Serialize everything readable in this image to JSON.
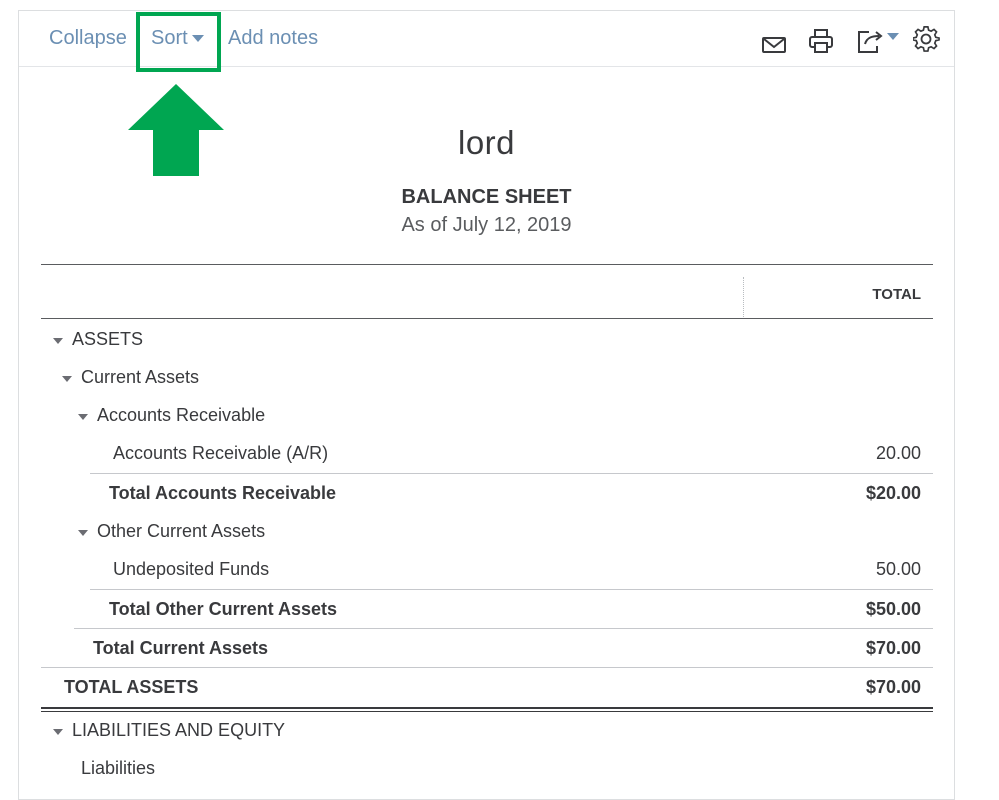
{
  "toolbar": {
    "collapse_label": "Collapse",
    "sort_label": "Sort",
    "add_notes_label": "Add notes",
    "icons": [
      "email-icon",
      "print-icon",
      "export-icon",
      "settings-icon"
    ]
  },
  "report": {
    "company": "lord",
    "title": "BALANCE SHEET",
    "date": "As of July 12, 2019",
    "column_header": "TOTAL"
  },
  "rows": [
    {
      "label": "ASSETS",
      "amount": ""
    },
    {
      "label": "Current Assets",
      "amount": ""
    },
    {
      "label": "Accounts Receivable",
      "amount": ""
    },
    {
      "label": "Accounts Receivable (A/R)",
      "amount": "20.00"
    },
    {
      "label": "Total Accounts Receivable",
      "amount": "$20.00"
    },
    {
      "label": "Other Current Assets",
      "amount": ""
    },
    {
      "label": "Undeposited Funds",
      "amount": "50.00"
    },
    {
      "label": "Total Other Current Assets",
      "amount": "$50.00"
    },
    {
      "label": "Total Current Assets",
      "amount": "$70.00"
    },
    {
      "label": "TOTAL ASSETS",
      "amount": "$70.00"
    },
    {
      "label": "LIABILITIES AND EQUITY",
      "amount": ""
    },
    {
      "label": "Liabilities",
      "amount": ""
    }
  ],
  "colors": {
    "link": "#6b8fb3",
    "highlight": "#00a651",
    "text": "#393a3d"
  }
}
